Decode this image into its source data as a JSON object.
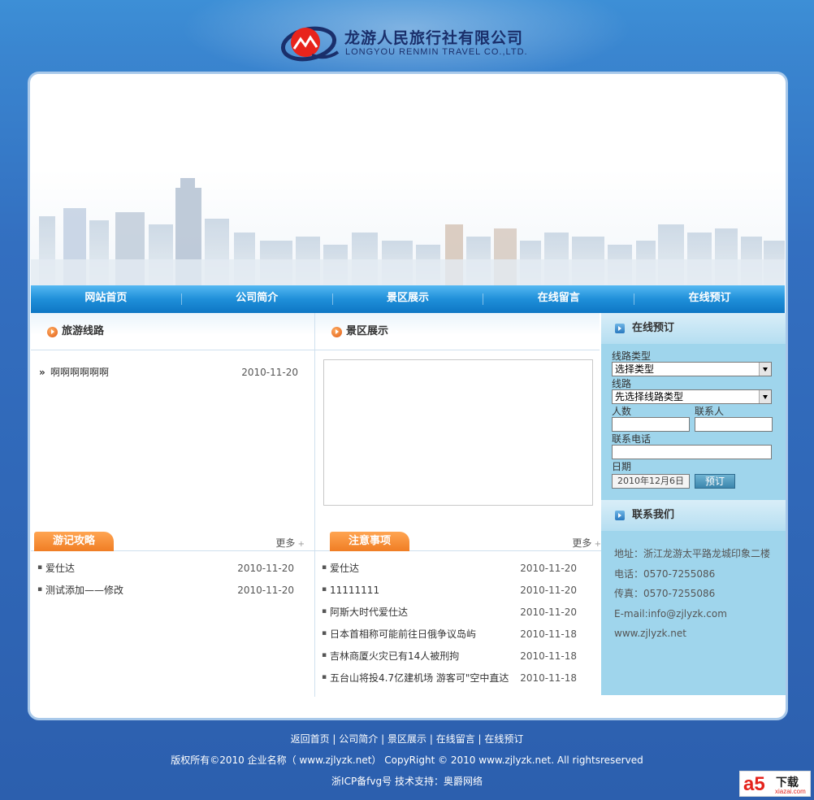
{
  "header": {
    "company_cn": "龙游人民旅行社有限公司",
    "company_en": "LONGYOU RENMIN TRAVEL CO.,LTD."
  },
  "nav": {
    "items": [
      "网站首页",
      "公司简介",
      "景区展示",
      "在线留言",
      "在线预订"
    ]
  },
  "routes": {
    "title": "旅游线路",
    "items": [
      {
        "title": "啊啊啊啊啊啊",
        "date": "2010-11-20"
      }
    ]
  },
  "scenic": {
    "title": "景区展示"
  },
  "travel_notes": {
    "title": "游记攻略",
    "more": "更多",
    "items": [
      {
        "title": "爱仕达",
        "date": "2010-11-20"
      },
      {
        "title": "测试添加——修改",
        "date": "2010-11-20"
      }
    ]
  },
  "notices": {
    "title": "注意事项",
    "more": "更多",
    "items": [
      {
        "title": "爱仕达",
        "date": "2010-11-20"
      },
      {
        "title": "11111111",
        "date": "2010-11-20"
      },
      {
        "title": "阿斯大时代爱仕达",
        "date": "2010-11-20"
      },
      {
        "title": "日本首相称可能前往日俄争议岛屿",
        "date": "2010-11-18"
      },
      {
        "title": "吉林商厦火灾已有14人被刑拘",
        "date": "2010-11-18"
      },
      {
        "title": "五台山将投4.7亿建机场 游客可\"空中直达",
        "date": "2010-11-18"
      }
    ]
  },
  "booking": {
    "title": "在线预订",
    "route_type_label": "线路类型",
    "route_type_value": "选择类型",
    "route_label": "线路",
    "route_value": "先选择线路类型",
    "people_label": "人数",
    "contact_label": "联系人",
    "phone_label": "联系电话",
    "date_label": "日期",
    "date_value": "2010年12月6日",
    "submit_label": "预订"
  },
  "contact": {
    "title": "联系我们",
    "address": "地址：浙江龙游太平路龙城印象二楼",
    "phone": "电话：0570-7255086",
    "fax": "传真：0570-7255086",
    "email": "E-mail:info@zjlyzk.com",
    "website": "www.zjlyzk.net"
  },
  "footer": {
    "links": [
      "返回首页",
      "公司简介",
      "景区展示",
      "在线留言",
      "在线预订"
    ],
    "copyright": "版权所有©2010 企业名称（ www.zjlyzk.net）   CopyRight © 2010 www.zjlyzk.net. All rightsreserved",
    "icp": "浙ICP备fvg号  技术支持：奥爵网络"
  },
  "watermark": {
    "mark": "a5",
    "text": "下载",
    "site": "xiazai.com"
  },
  "colors": {
    "nav_blue": "#1f8fd9",
    "tab_orange": "#f07d24",
    "side_panel": "#9fd5ec",
    "page_bg": "#336fc0"
  }
}
